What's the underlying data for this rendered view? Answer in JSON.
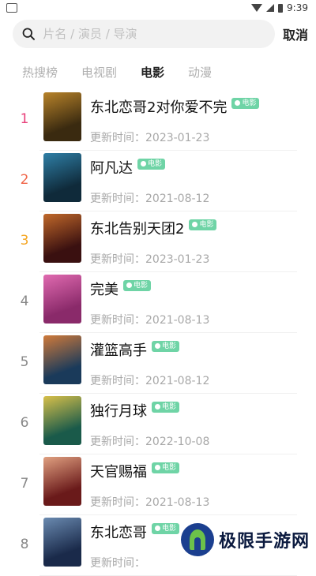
{
  "status_bar": {
    "time": "9:39"
  },
  "search": {
    "placeholder": "片名 / 演员 / 导演",
    "value": "",
    "cancel_label": "取消"
  },
  "tabs": [
    {
      "label": "热搜榜",
      "active": false
    },
    {
      "label": "电视剧",
      "active": false
    },
    {
      "label": "电影",
      "active": true
    },
    {
      "label": "动漫",
      "active": false
    }
  ],
  "tag_label": "电影",
  "colors": {
    "rank1": "#e8407a",
    "rank2": "#f0664a",
    "rank3": "#f5a623",
    "rank_other": "#888888",
    "tag": "#6fd4a6"
  },
  "items": [
    {
      "rank": "1",
      "title": "东北恋哥2对你爱不完",
      "date": "更新时间：2023-01-23"
    },
    {
      "rank": "2",
      "title": "阿凡达",
      "date": "更新时间：2021-08-12"
    },
    {
      "rank": "3",
      "title": "东北告别天团2",
      "date": "更新时间：2023-01-23"
    },
    {
      "rank": "4",
      "title": "完美",
      "date": "更新时间：2021-08-13"
    },
    {
      "rank": "5",
      "title": "灌篮高手",
      "date": "更新时间：2021-08-12"
    },
    {
      "rank": "6",
      "title": "独行月球",
      "date": "更新时间：2022-10-08"
    },
    {
      "rank": "7",
      "title": "天官赐福",
      "date": "更新时间：2021-08-13"
    },
    {
      "rank": "8",
      "title": "东北恋哥",
      "date": "更新时间："
    }
  ],
  "watermark": {
    "text": "极限手游网"
  }
}
